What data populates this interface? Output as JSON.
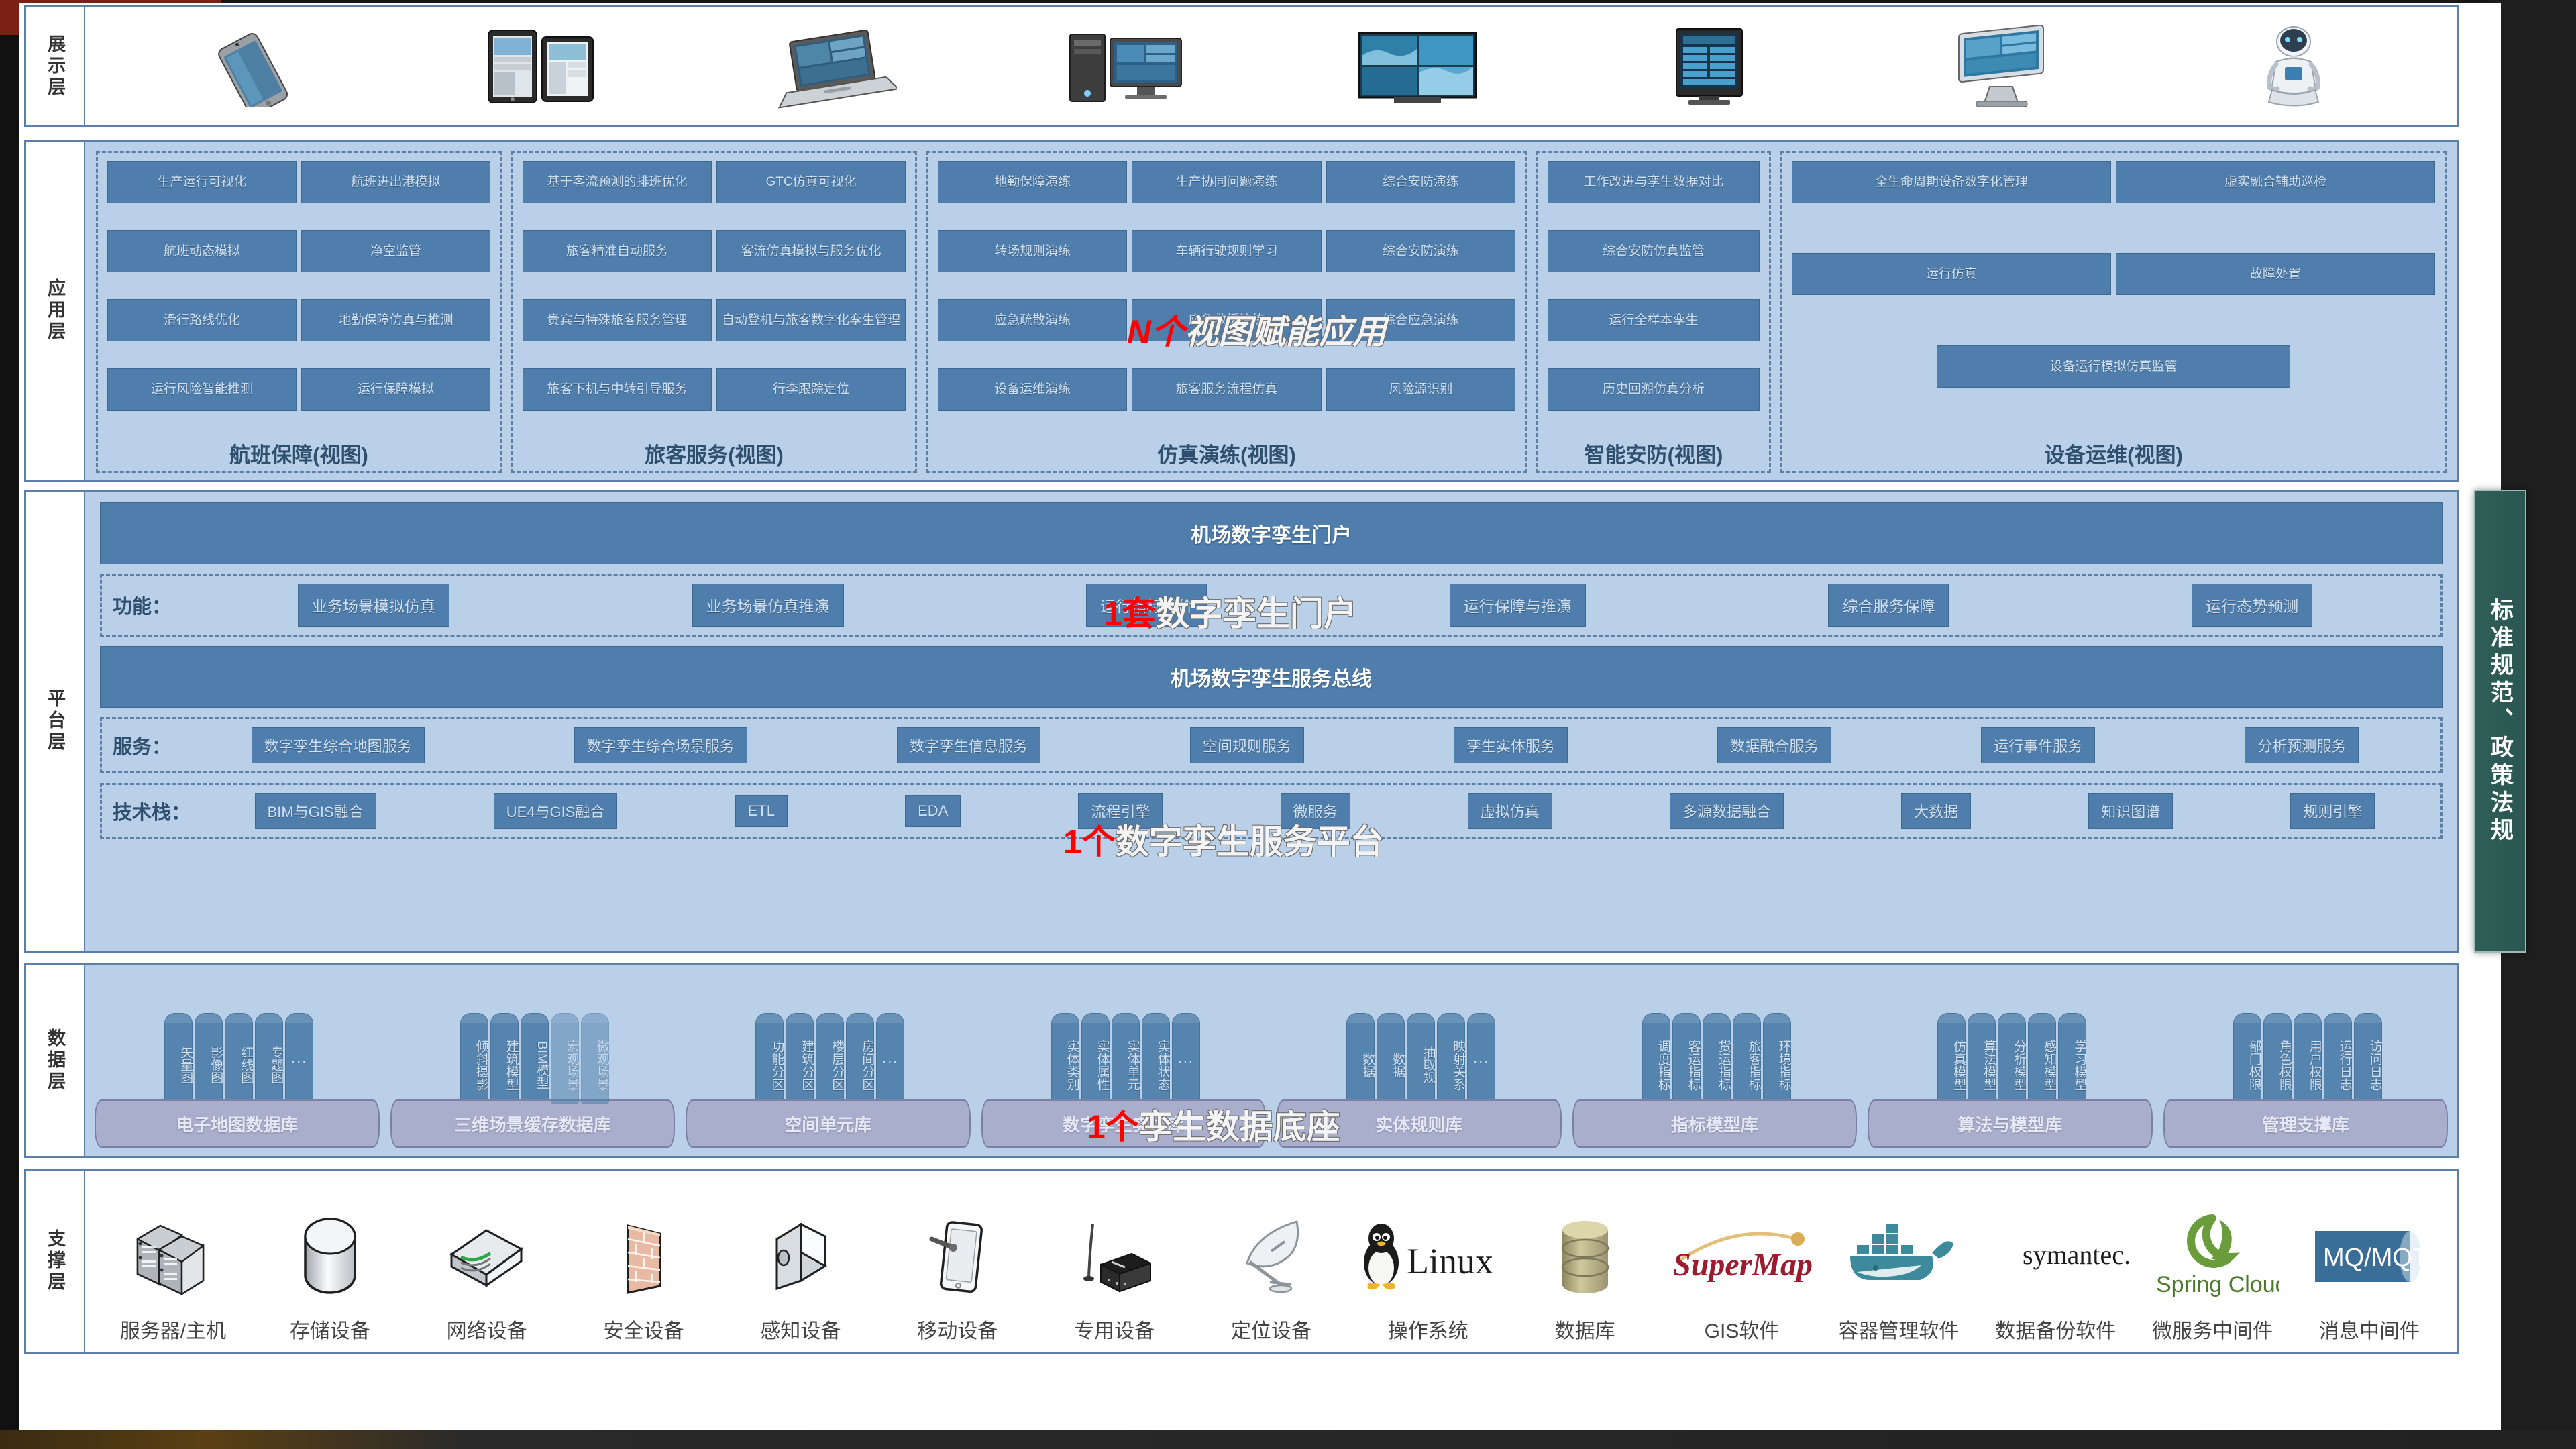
{
  "layers": {
    "presentation": "展示层",
    "application": "应用层",
    "platform": "平台层",
    "data": "数据层",
    "support": "支撑层"
  },
  "standards_bar": "标准规范、政策法规",
  "presentation": {
    "devices": [
      {
        "name": "smartphone-icon",
        "label": "手机"
      },
      {
        "name": "tablet-icon",
        "label": "平板"
      },
      {
        "name": "laptop-icon",
        "label": "笔记本"
      },
      {
        "name": "desktop-pc-icon",
        "label": "台式机"
      },
      {
        "name": "video-wall-icon",
        "label": "大屏"
      },
      {
        "name": "kiosk-display-icon",
        "label": "信息屏"
      },
      {
        "name": "touch-kiosk-icon",
        "label": "触摸一体机"
      },
      {
        "name": "service-robot-icon",
        "label": "服务机器人"
      }
    ]
  },
  "application": {
    "groups": [
      {
        "title": "航班保障(视图)",
        "items": [
          "生产运行可视化",
          "航班进出港模拟",
          "航班动态模拟",
          "净空监管",
          "滑行路线优化",
          "地勤保障仿真与推测",
          "运行风险智能推测",
          "运行保障模拟"
        ]
      },
      {
        "title": "旅客服务(视图)",
        "items": [
          "基于客流预测的排班优化",
          "GTC仿真可视化",
          "旅客精准自动服务",
          "客流仿真模拟与服务优化",
          "贵宾与特殊旅客服务管理",
          "自动登机与旅客数字化孪生管理",
          "旅客下机与中转引导服务",
          "行李跟踪定位"
        ]
      },
      {
        "title": "仿真演练(视图)",
        "items": [
          "地勤保障演练",
          "生产协同问题演练",
          "综合安防演练",
          "转场规则演练",
          "车辆行驶规则学习",
          "综合安防演练",
          "应急疏散演练",
          "应急救援演练",
          "综合应急演练",
          "设备运维演练",
          "旅客服务流程仿真",
          "风险源识别"
        ]
      },
      {
        "title": "智能安防(视图)",
        "items": [
          "工作改进与孪生数据对比",
          "综合安防仿真监管",
          "运行全样本孪生",
          "历史回溯仿真分析"
        ]
      },
      {
        "title": "设备运维(视图)",
        "items": [
          "全生命周期设备数字化管理",
          "虚实融合辅助巡检",
          "运行仿真",
          "故障处置",
          "设备运行模拟仿真监管"
        ]
      }
    ]
  },
  "platform": {
    "portal_bar": "机场数字孪生门户",
    "bus_bar": "机场数字孪生服务总线",
    "function_label": "功能：",
    "functions": [
      "业务场景模拟仿真",
      "业务场景仿真推演",
      "运行指标评价",
      "运行保障与推演",
      "综合服务保障",
      "运行态势预测"
    ],
    "service_label": "服务：",
    "services": [
      "数字孪生综合地图服务",
      "数字孪生综合场景服务",
      "数字孪生信息服务",
      "空间规则服务",
      "孪生实体服务",
      "数据融合服务",
      "运行事件服务",
      "分析预测服务"
    ],
    "tech_label": "技术栈：",
    "techstack": [
      "BIM与GIS融合",
      "UE4与GIS融合",
      "ETL",
      "EDA",
      "流程引擎",
      "微服务",
      "虚拟仿真",
      "多源数据融合",
      "大数据",
      "知识图谱",
      "规则引擎"
    ]
  },
  "data": {
    "databases": [
      {
        "base": "电子地图数据库",
        "tubes": [
          "矢量图",
          "影像图",
          "红线图",
          "专题图",
          "..."
        ]
      },
      {
        "base": "三维场景缓存数据库",
        "tubes": [
          "倾斜摄影",
          "建筑模型",
          "BIM模型",
          "宏观场景",
          "微观场景"
        ]
      },
      {
        "base": "空间单元库",
        "tubes": [
          "功能分区",
          "建筑分区",
          "楼层分区",
          "房间分区",
          "..."
        ]
      },
      {
        "base": "数字孪生实体库",
        "tubes": [
          "实体类别",
          "实体属性",
          "实体单元",
          "实体状态",
          "..."
        ]
      },
      {
        "base": "实体规则库",
        "tubes": [
          "数据",
          "数据",
          "抽取规",
          "映射关系",
          "..."
        ]
      },
      {
        "base": "指标模型库",
        "tubes": [
          "调度指标",
          "客运指标",
          "货运指标",
          "旅客指标",
          "环境指标"
        ]
      },
      {
        "base": "算法与模型库",
        "tubes": [
          "仿真模型",
          "算法模型",
          "分析模型",
          "感知模型",
          "学习模型"
        ]
      },
      {
        "base": "管理支撑库",
        "tubes": [
          "部门权限",
          "角色权限",
          "用户权限",
          "运行日志",
          "访问日志"
        ]
      }
    ]
  },
  "support": {
    "items": [
      {
        "icon": "server-rack-icon",
        "label": "服务器/主机"
      },
      {
        "icon": "storage-cylinder-icon",
        "label": "存储设备"
      },
      {
        "icon": "network-switch-icon",
        "label": "网络设备"
      },
      {
        "icon": "firewall-brick-icon",
        "label": "安全设备"
      },
      {
        "icon": "sensor-camera-icon",
        "label": "感知设备"
      },
      {
        "icon": "mobile-tablet-icon",
        "label": "移动设备"
      },
      {
        "icon": "antenna-box-icon",
        "label": "专用设备"
      },
      {
        "icon": "satellite-dish-icon",
        "label": "定位设备"
      },
      {
        "icon": "linux-penguin-icon",
        "label": "操作系统",
        "brand": "Linux"
      },
      {
        "icon": "database-cylinder-icon",
        "label": "数据库"
      },
      {
        "icon": "supermap-logo-icon",
        "label": "GIS软件",
        "brand": "SuperMap"
      },
      {
        "icon": "docker-whale-icon",
        "label": "容器管理软件"
      },
      {
        "icon": "symantec-logo-icon",
        "label": "数据备份软件",
        "brand": "symantec."
      },
      {
        "icon": "spring-cloud-logo-icon",
        "label": "微服务中间件",
        "brand": "Spring Cloud"
      },
      {
        "icon": "mq-mqtt-logo-icon",
        "label": "消息中间件",
        "brand": "MQ/MQTT"
      }
    ]
  },
  "annotations": [
    {
      "red": "N个",
      "white": "视图赋能应用"
    },
    {
      "red": "1套",
      "white": "数字孪生门户"
    },
    {
      "red": "1个",
      "white": "数字孪生服务平台"
    },
    {
      "red": "1个",
      "white": "孪生数据底座"
    }
  ],
  "colors": {
    "layer_bg": "#b9d0e8",
    "box_blue": "#4f7ead",
    "border_blue": "#5b7fa6",
    "db_base": "#a9aecd",
    "std_green": "#2f5f58",
    "accent_red": "#ff0000"
  }
}
